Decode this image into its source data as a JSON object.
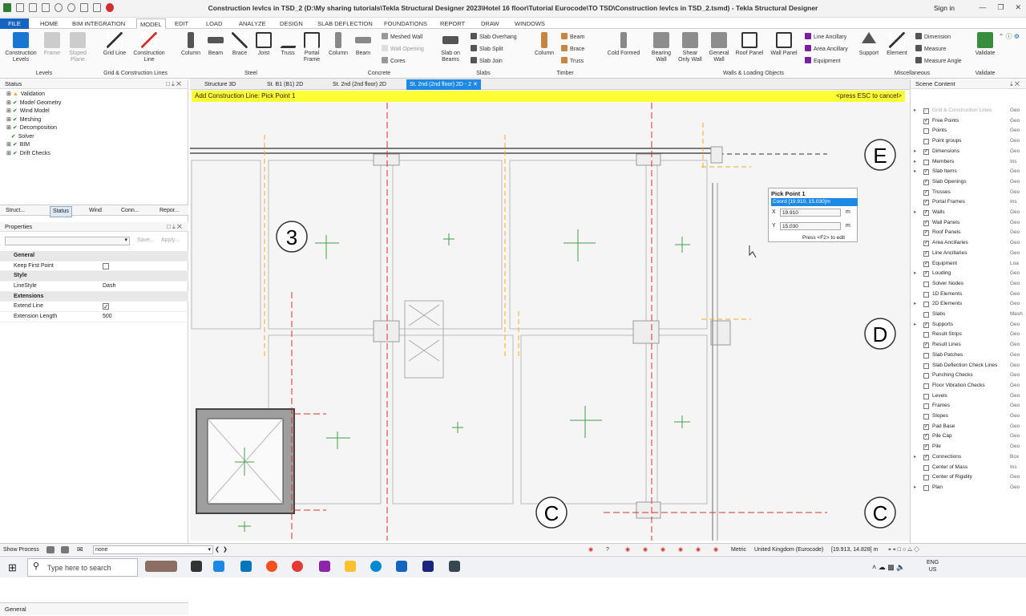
{
  "window": {
    "title": "Construction levlcs in TSD_2 (D:\\My sharing tutorials\\Tekla Structural Designer 2023\\Hotel 16 floor\\Tutorial Eurocode\\TO TSD\\Construction levlcs in TSD_2.tsmd) - Tekla Structural Designer",
    "signin": "Sign in"
  },
  "menu_tabs": [
    "FILE",
    "HOME",
    "BIM INTEGRATION",
    "MODEL",
    "EDIT",
    "LOAD",
    "ANALYZE",
    "DESIGN",
    "SLAB DEFLECTION",
    "FOUNDATIONS",
    "REPORT",
    "DRAW",
    "WINDOWS"
  ],
  "ribbon": {
    "buttons": [
      "Construction Levels",
      "Frame",
      "Sloped Plane",
      "Grid Line",
      "Construction Line",
      "Column",
      "Beam",
      "Brace",
      "Joist",
      "Truss",
      "Portal Frame",
      "Column",
      "Beam",
      "Slab on Beams",
      "Column",
      "Cold Formed",
      "Bearing Wall",
      "Shear Only Wall",
      "General Wall",
      "Roof Panel",
      "Wall Panel",
      "Support",
      "Element",
      "Validate"
    ],
    "small": {
      "concrete": [
        "Meshed Wall",
        "Wall Opening",
        "Cores"
      ],
      "slabs": [
        "Slab Overhang",
        "Slab Split",
        "Slab Join"
      ],
      "timber": [
        "Beam",
        "Brace",
        "Truss"
      ],
      "walls": [
        "Line Ancillary",
        "Area Ancillary",
        "Equipment"
      ],
      "misc": [
        "Dimension",
        "Measure",
        "Measure Angle"
      ]
    },
    "groups": [
      "Levels",
      "Grid & Construction Lines",
      "Steel",
      "Concrete",
      "Slabs",
      "Timber",
      "Walls & Loading Objects",
      "Miscellaneous",
      "Validate"
    ]
  },
  "status_panel": {
    "title": "Status",
    "items": [
      "Validation",
      "Model Geometry",
      "Wind Model",
      "Meshing",
      "Decomposition",
      "Solver",
      "BIM",
      "Drift Checks"
    ],
    "tabs": [
      "Struct...",
      "Status",
      "Wind",
      "Conn...",
      "Repor..."
    ]
  },
  "properties": {
    "title": "Properties",
    "save": "Save...",
    "apply": "Apply...",
    "rows": [
      {
        "type": "section",
        "key": "General"
      },
      {
        "type": "check",
        "key": "Keep First Point",
        "checked": false
      },
      {
        "type": "section",
        "key": "Style"
      },
      {
        "type": "text",
        "key": "LineStyle",
        "value": "Dash"
      },
      {
        "type": "section",
        "key": "Extensions"
      },
      {
        "type": "check",
        "key": "Extend Line",
        "checked": true
      },
      {
        "type": "text",
        "key": "Extension Length",
        "value": "500"
      }
    ],
    "footer": "General"
  },
  "view_tabs": [
    "Structure 3D",
    "St. B1 (B1) 2D",
    "St. 2nd (2nd floor) 2D",
    "St. 2nd (2nd floor) 2D - 2"
  ],
  "banner": {
    "left": "Add Construction Line: Pick Point 1",
    "right": "<press ESC to cancel>"
  },
  "grid_labels": [
    "E",
    "D",
    "C",
    "3"
  ],
  "pick_box": {
    "title": "Pick Point 1",
    "coord": "Coord [19.910, 15.030]m",
    "x_label": "X",
    "x_value": "19.910",
    "y_label": "Y",
    "y_value": "15.030",
    "unit": "m",
    "hint": "Press <F2> to edit"
  },
  "scene": {
    "title": "Scene Content",
    "items": [
      {
        "name": "Grid & Construction Lines",
        "checked": true,
        "s": "Geo",
        "exp": true
      },
      {
        "name": "Free Points",
        "checked": true,
        "s": "Geo",
        "exp": false
      },
      {
        "name": "Points",
        "checked": false,
        "s": "Geo",
        "exp": false
      },
      {
        "name": "Point groups",
        "checked": false,
        "s": "Geo",
        "exp": false
      },
      {
        "name": "Dimensions",
        "checked": true,
        "s": "Geo",
        "exp": true
      },
      {
        "name": "Members",
        "checked": false,
        "s": "Ins",
        "exp": true
      },
      {
        "name": "Slab Items",
        "checked": true,
        "s": "Geo",
        "exp": true
      },
      {
        "name": "Slab Openings",
        "checked": true,
        "s": "Geo",
        "exp": false
      },
      {
        "name": "Trusses",
        "checked": true,
        "s": "Geo",
        "exp": false
      },
      {
        "name": "Portal Frames",
        "checked": true,
        "s": "Ins",
        "exp": false
      },
      {
        "name": "Walls",
        "checked": true,
        "s": "Geo",
        "exp": true
      },
      {
        "name": "Wall Panels",
        "checked": true,
        "s": "Geo",
        "exp": false
      },
      {
        "name": "Roof Panels",
        "checked": true,
        "s": "Geo",
        "exp": false
      },
      {
        "name": "Area Ancillaries",
        "checked": true,
        "s": "Geo",
        "exp": false
      },
      {
        "name": "Line Ancillaries",
        "checked": true,
        "s": "Geo",
        "exp": false
      },
      {
        "name": "Equipment",
        "checked": true,
        "s": "Loa",
        "exp": false
      },
      {
        "name": "Louding",
        "checked": true,
        "s": "Geo",
        "exp": true
      },
      {
        "name": "Solver Nodes",
        "checked": false,
        "s": "Geo",
        "exp": false
      },
      {
        "name": "1D Elements",
        "checked": false,
        "s": "Geo",
        "exp": false
      },
      {
        "name": "2D Elements",
        "checked": false,
        "s": "Geo",
        "exp": true
      },
      {
        "name": "Slabs",
        "checked": false,
        "s": "Mesh",
        "exp": false
      },
      {
        "name": "Supports",
        "checked": true,
        "s": "Geo",
        "exp": true
      },
      {
        "name": "Result Strips",
        "checked": false,
        "s": "Geo",
        "exp": false
      },
      {
        "name": "Result Lines",
        "checked": true,
        "s": "Geo",
        "exp": false
      },
      {
        "name": "Slab Patches",
        "checked": false,
        "s": "Geo",
        "exp": false
      },
      {
        "name": "Slab Deflection Check Lines",
        "checked": false,
        "s": "Geo",
        "exp": false
      },
      {
        "name": "Punching Checks",
        "checked": false,
        "s": "Geo",
        "exp": false
      },
      {
        "name": "Floor Vibration Checks",
        "checked": false,
        "s": "Geo",
        "exp": false
      },
      {
        "name": "Levels",
        "checked": false,
        "s": "Geo",
        "exp": false
      },
      {
        "name": "Frames",
        "checked": false,
        "s": "Geo",
        "exp": false
      },
      {
        "name": "Slopes",
        "checked": false,
        "s": "Geo",
        "exp": false
      },
      {
        "name": "Pad Base",
        "checked": true,
        "s": "Geo",
        "exp": false
      },
      {
        "name": "Pile Cap",
        "checked": true,
        "s": "Geo",
        "exp": false
      },
      {
        "name": "Pile",
        "checked": true,
        "s": "Geo",
        "exp": false
      },
      {
        "name": "Connections",
        "checked": true,
        "s": "Box",
        "exp": true
      },
      {
        "name": "Center of Mass",
        "checked": false,
        "s": "Ins",
        "exp": false
      },
      {
        "name": "Center of Rigidity",
        "checked": false,
        "s": "Geo",
        "exp": false
      },
      {
        "name": "Plan",
        "checked": false,
        "s": "Geo",
        "exp": true
      }
    ]
  },
  "statusbar": {
    "show_process": "Show Process",
    "none": "none",
    "metric": "Metric",
    "region": "United Kingdom (Eurocode)",
    "coords": "[19.913, 14.828] m"
  },
  "taskbar": {
    "search": "Type here to search",
    "lang": "ENG",
    "region": "US"
  },
  "colors": {
    "accent": "#1565c0",
    "banner": "#ffff33",
    "gridline": "#d32f2f",
    "support": "#2e7d32"
  }
}
